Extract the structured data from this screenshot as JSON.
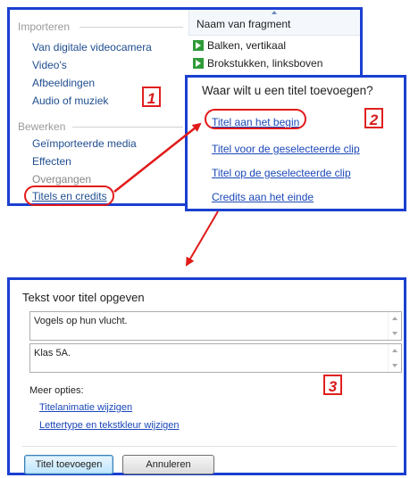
{
  "panel1": {
    "section_import": "Importeren",
    "import_items": [
      {
        "label": "Van digitale videocamera"
      },
      {
        "label": "Video's"
      },
      {
        "label": "Afbeeldingen"
      },
      {
        "label": "Audio of muziek"
      }
    ],
    "section_edit": "Bewerken",
    "edit_items": [
      {
        "label": "Geïmporteerde media"
      },
      {
        "label": "Effecten"
      },
      {
        "label": "Overgangen"
      },
      {
        "label": "Titels en credits"
      }
    ],
    "column_header": "Naam van fragment",
    "fragments": [
      {
        "label": "Balken, vertikaal",
        "icon": "clip-play-icon"
      },
      {
        "label": "Brokstukken, linksboven",
        "icon": "clip-play-icon"
      }
    ],
    "badge": "1"
  },
  "panel2": {
    "heading": "Waar wilt u een titel toevoegen?",
    "links": [
      {
        "label": "Titel aan het begin"
      },
      {
        "label": "Titel voor de geselecteerde clip"
      },
      {
        "label": "Titel op de geselecteerde clip"
      },
      {
        "label": "Credits aan het einde"
      }
    ],
    "badge": "2"
  },
  "dialog": {
    "title": "Tekst voor titel opgeven",
    "line1": "Vogels op hun vlucht.",
    "line2": "Klas 5A.",
    "more_options": "Meer opties:",
    "option_links": [
      {
        "label": "Titelanimatie wijzigen"
      },
      {
        "label": "Lettertype en tekstkleur wijzigen"
      }
    ],
    "add_button": "Titel toevoegen",
    "cancel_button": "Annuleren",
    "badge": "3"
  },
  "colors": {
    "frame_border": "#1a3fd0",
    "annotation_red": "#e21a1a",
    "link_blue": "#1a47b8"
  }
}
